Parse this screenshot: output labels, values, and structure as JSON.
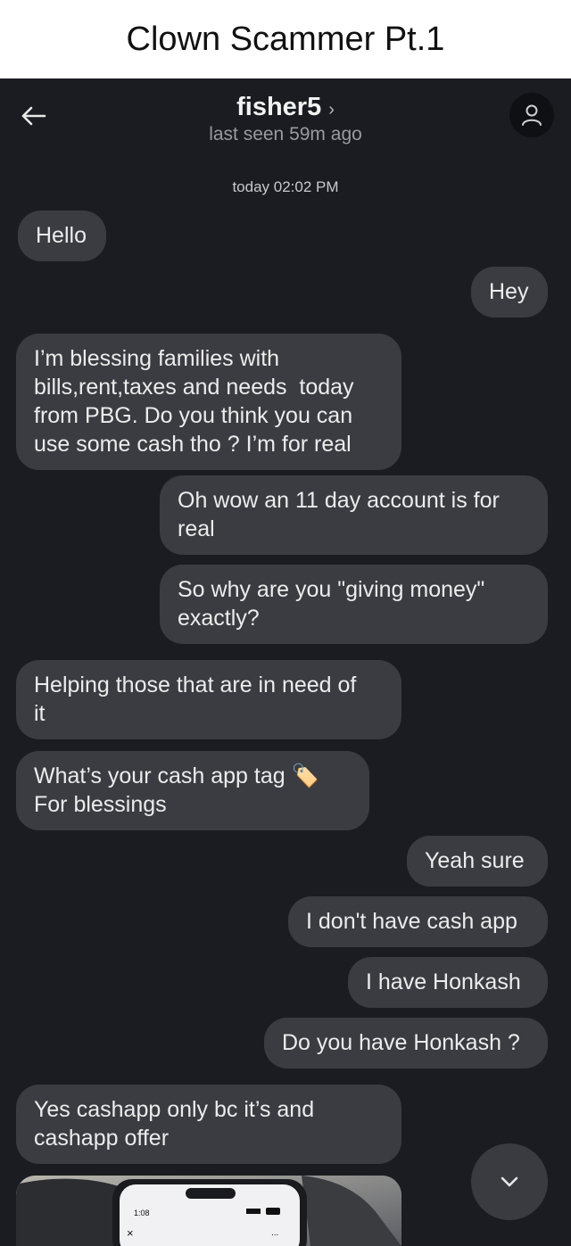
{
  "caption": "Clown Scammer Pt.1",
  "header": {
    "username": "fisher5",
    "chevron": "›",
    "status": "last seen 59m ago",
    "back_icon": "arrow-left-icon",
    "avatar_icon": "user-icon"
  },
  "timestamp": "today 02:02 PM",
  "messages": [
    {
      "from": "them",
      "text": "Hello"
    },
    {
      "from": "me",
      "text": "Hey"
    },
    {
      "from": "them",
      "text": "I’m blessing families with\nbills,rent,taxes and needs  today\nfrom PBG. Do you think you can\nuse some cash tho ? I’m for real"
    },
    {
      "from": "me",
      "text": "Oh wow an 11 day account is for\nreal"
    },
    {
      "from": "me",
      "text": "So why are you \"giving money\"\nexactly?"
    },
    {
      "from": "them",
      "text": "Helping those that are in need of\nit"
    },
    {
      "from": "them",
      "text": "What’s your cash app tag",
      "emoji": "🏷️",
      "text2": "For blessings"
    },
    {
      "from": "me",
      "text": "Yeah sure"
    },
    {
      "from": "me",
      "text": "I don't have cash app"
    },
    {
      "from": "me",
      "text": "I have Honkash"
    },
    {
      "from": "me",
      "text": "Do you have Honkash ?"
    },
    {
      "from": "them",
      "text": "Yes cashapp only bc it’s and\ncashapp offer"
    }
  ],
  "attachment": {
    "status_time": "1:08",
    "close_glyph": "×",
    "menu_glyph": "..."
  },
  "scroll_button": {
    "icon": "chevron-down-icon"
  },
  "colors": {
    "background": "#1b1c21",
    "bubble": "#3b3c41",
    "text": "#ececec",
    "muted": "#9a9a9e"
  }
}
